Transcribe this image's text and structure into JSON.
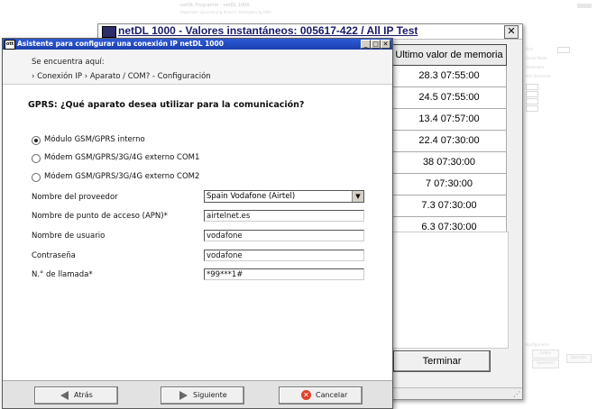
{
  "background_app": {
    "title": "netDL Programm - netDL 1000",
    "menu": "Allgemein  Speicherung  Ansicht  Verlängerung  Hilfe",
    "side_labels": [
      "Port",
      "Serial Mode",
      "Verbinden",
      "Info Elemente"
    ],
    "side_buttons": [
      "Konfigurieren",
      "Laden",
      "Speichern",
      "Beenden"
    ]
  },
  "values_window": {
    "title": "netDL 1000 - Valores instantáneos: 005617-422 / All IP Test",
    "close_label": "✕",
    "column_header": "Ultimo valor de memoria",
    "rows": [
      "28.3  07:55:00",
      "24.5  07:55:00",
      "13.4  07:57:00",
      "22.4  07:30:00",
      "38  07:30:00",
      "7  07:30:00",
      "7.3  07:30:00",
      "6.3  07:30:00"
    ],
    "terminate_label": "Terminar"
  },
  "wizard": {
    "title": "Asistente para configurar una conexión IP  netDL 1000",
    "icon_label": "ott",
    "controls": [
      "_",
      "□",
      "✕"
    ],
    "location_label": "Se encuentra aquí:",
    "breadcrumb": "› Conexión IP  › Aparato / COM? - Configuración",
    "heading": "GPRS:  ¿Qué aparato desea utilizar para la comunicación?",
    "device_options": [
      {
        "label": "Módulo GSM/GPRS interno",
        "checked": true
      },
      {
        "label": "Módem GSM/GPRS/3G/4G externo COM1",
        "checked": false
      },
      {
        "label": "Módem GSM/GPRS/3G/4G externo COM2",
        "checked": false
      }
    ],
    "fields": {
      "provider_label": "Nombre del proveedor",
      "provider_value": "Spain  Vodafone (Airtel)",
      "apn_label": "Nombre de punto de acceso (APN)*",
      "apn_value": "airtelnet.es",
      "user_label": "Nombre de usuario",
      "user_value": "vodafone",
      "password_label": "Contraseña",
      "password_value": "vodafone",
      "number_label": "N.° de llamada*",
      "number_value": "*99***1#"
    },
    "buttons": {
      "back": "Atrás",
      "next": "Siguiente",
      "cancel": "Cancelar"
    }
  },
  "colors": {
    "wizard_titlebar": "#1a3fae",
    "values_title": "#1a1a6a",
    "cancel_icon": "#e0402a"
  }
}
